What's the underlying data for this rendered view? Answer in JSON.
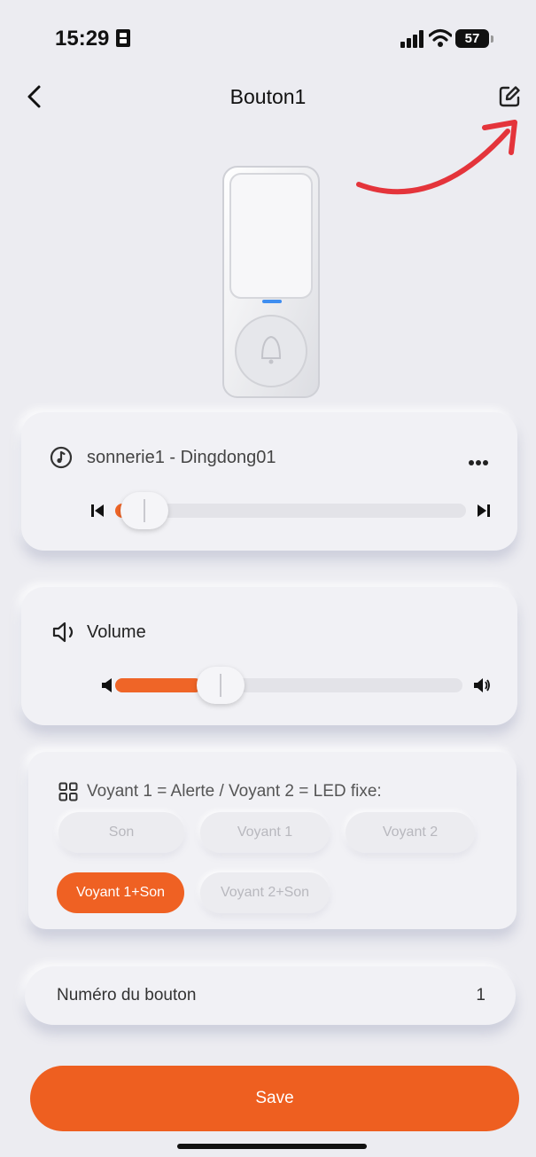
{
  "status_bar": {
    "time": "15:29",
    "battery": "57",
    "icons": [
      "sim-card-icon",
      "cellular-signal-icon",
      "wifi-icon",
      "battery-icon"
    ]
  },
  "nav": {
    "title": "Bouton1",
    "back_icon": "chevron-left-icon",
    "edit_icon": "edit-icon"
  },
  "annotation": {
    "icon": "red-curved-arrow",
    "color": "#e4343b"
  },
  "ringtone": {
    "label": "sonnerie1 - Dingdong01",
    "icon": "music-note-icon",
    "more_icon": "more-icon",
    "progress": 0.03,
    "prev_icon": "skip-previous-icon",
    "next_icon": "skip-next-icon"
  },
  "volume": {
    "label": "Volume",
    "icon": "speaker-icon",
    "level": 0.25,
    "low_icon": "volume-low-icon",
    "high_icon": "volume-high-icon"
  },
  "mode": {
    "label": "Voyant 1 = Alerte / Voyant 2 = LED fixe:",
    "icon": "grid-icon",
    "options": [
      {
        "label": "Son",
        "active": false
      },
      {
        "label": "Voyant 1",
        "active": false
      },
      {
        "label": "Voyant 2",
        "active": false
      },
      {
        "label": "Voyant 1+Son",
        "active": true
      },
      {
        "label": "Voyant 2+Son",
        "active": false
      }
    ]
  },
  "button_number": {
    "label": "Numéro du bouton",
    "value": "1"
  },
  "save_label": "Save",
  "colors": {
    "accent": "#ef6123",
    "background": "#ececf1",
    "card": "#f1f1f5"
  }
}
